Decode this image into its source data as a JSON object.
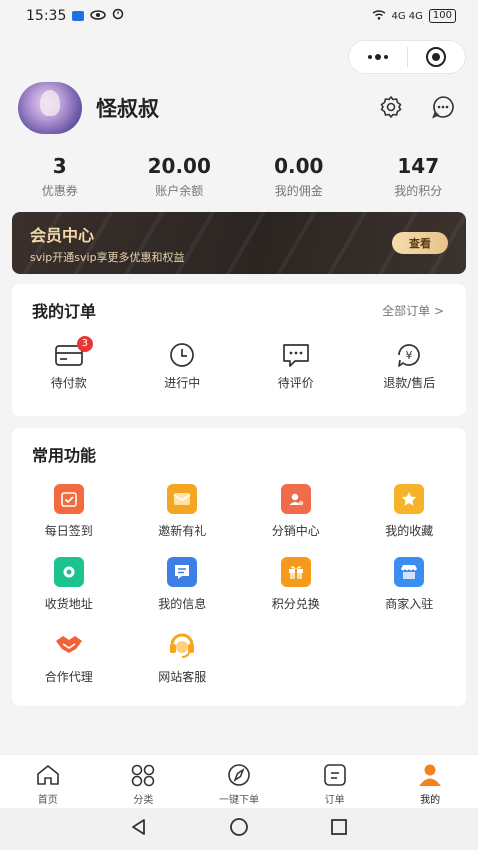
{
  "status_bar": {
    "time": "15:35",
    "network": "4G 4G",
    "battery": "100"
  },
  "profile": {
    "username": "怪叔叔"
  },
  "stats": [
    {
      "value": "3",
      "label": "优惠券"
    },
    {
      "value": "20.00",
      "label": "账户余额"
    },
    {
      "value": "0.00",
      "label": "我的佣金"
    },
    {
      "value": "147",
      "label": "我的积分"
    }
  ],
  "vip": {
    "title": "会员中心",
    "subtitle": "svip开通svip享更多优惠和权益",
    "button": "查看"
  },
  "orders": {
    "title": "我的订单",
    "all_link": "全部订单 >",
    "items": [
      {
        "label": "待付款",
        "icon": "wallet-icon",
        "badge": "3"
      },
      {
        "label": "进行中",
        "icon": "clock-icon"
      },
      {
        "label": "待评价",
        "icon": "comment-icon"
      },
      {
        "label": "退款/售后",
        "icon": "refund-icon"
      }
    ]
  },
  "features": {
    "title": "常用功能",
    "items": [
      {
        "label": "每日签到",
        "icon": "calendar-check-icon",
        "color": "#f26a3d"
      },
      {
        "label": "邀新有礼",
        "icon": "envelope-icon",
        "color": "#f4a623"
      },
      {
        "label": "分销中心",
        "icon": "user-card-icon",
        "color": "#ef6b4a"
      },
      {
        "label": "我的收藏",
        "icon": "star-icon",
        "color": "#f6b32a"
      },
      {
        "label": "收货地址",
        "icon": "location-icon",
        "color": "#1cc38f"
      },
      {
        "label": "我的信息",
        "icon": "message-icon",
        "color": "#3d7fe6"
      },
      {
        "label": "积分兑换",
        "icon": "gift-icon",
        "color": "#f59a1c"
      },
      {
        "label": "商家入驻",
        "icon": "store-icon",
        "color": "#3b8ef0"
      },
      {
        "label": "合作代理",
        "icon": "handshake-icon",
        "color": "#f1623b"
      },
      {
        "label": "网站客服",
        "icon": "headset-icon",
        "color": "#f6a61e"
      }
    ]
  },
  "tabbar": [
    {
      "label": "首页",
      "icon": "home-icon"
    },
    {
      "label": "分类",
      "icon": "category-icon"
    },
    {
      "label": "一键下单",
      "icon": "compass-icon"
    },
    {
      "label": "订单",
      "icon": "order-icon"
    },
    {
      "label": "我的",
      "icon": "user-icon",
      "active": true,
      "color": "#f5821f"
    }
  ]
}
